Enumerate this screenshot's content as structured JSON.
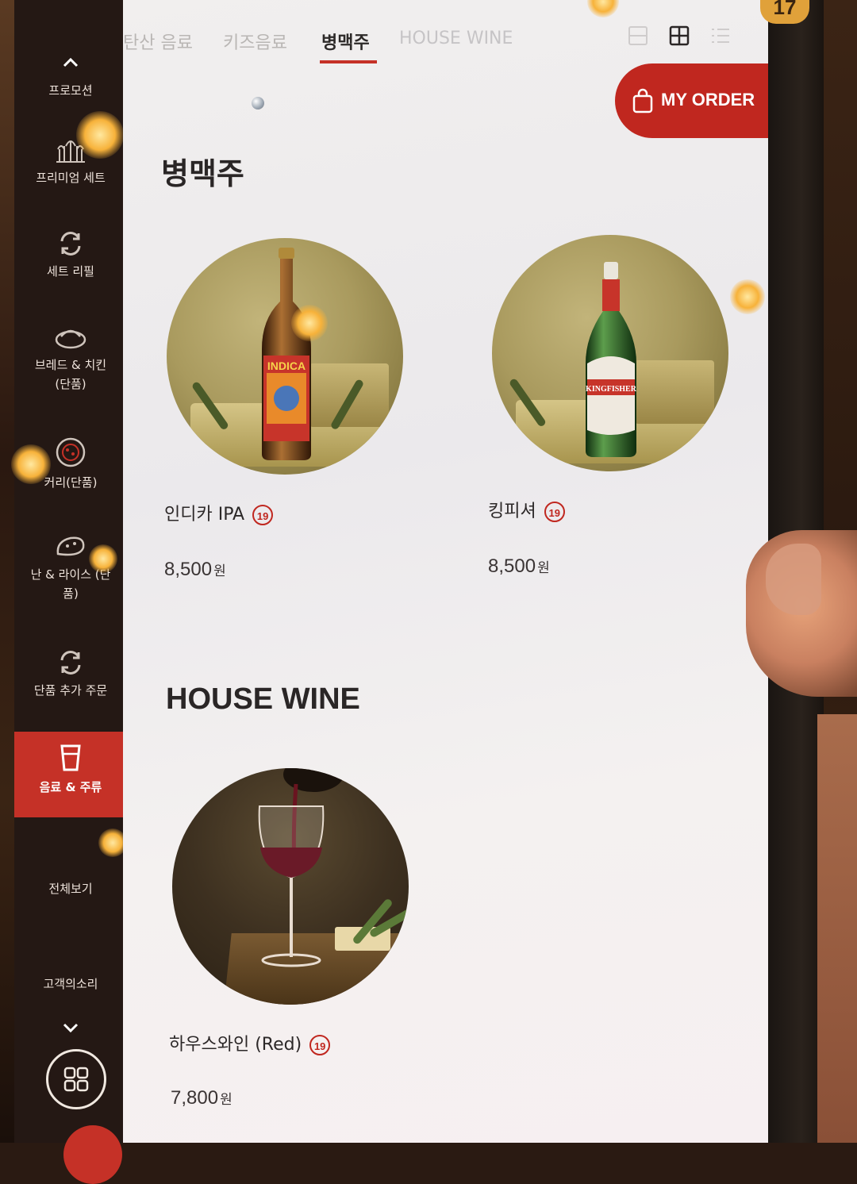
{
  "device": {
    "badge": "17"
  },
  "sidebar": {
    "items": [
      {
        "label": "프로모션",
        "icon": "chevron-up-icon"
      },
      {
        "label": "프리미엄 세트",
        "icon": "palace-icon"
      },
      {
        "label": "세트 리필",
        "icon": "refresh-icon"
      },
      {
        "label": "브레드 & 치킨\n(단품)",
        "line1": "브레드 & 치킨",
        "line2": "(단품)",
        "icon": "bread-icon"
      },
      {
        "label": "커리(단품)",
        "icon": "curry-bowl-icon"
      },
      {
        "label": "난 & 라이스 (단품)",
        "line1": "난 & 라이스 (단",
        "line2": "품)",
        "icon": "naan-icon"
      },
      {
        "label": "단품 추가 주문",
        "icon": "refresh-icon"
      },
      {
        "label": "음료 & 주류",
        "icon": "drink-cup-icon",
        "active": true
      },
      {
        "label": "전체보기"
      },
      {
        "label": "고객의소리"
      }
    ]
  },
  "tabs": [
    {
      "label": "탄산 음료"
    },
    {
      "label": "키즈음료"
    },
    {
      "label": "병맥주",
      "active": true
    },
    {
      "label": "HOUSE WINE"
    }
  ],
  "order_button": {
    "label": "MY ORDER"
  },
  "sections": [
    {
      "title": "병맥주",
      "products": [
        {
          "name": "인디카 IPA",
          "age": "19",
          "price": "8,500",
          "currency": "원",
          "bottle_label": "INDICA",
          "image": "indica-ipa-bottle"
        },
        {
          "name": "킹피셔",
          "age": "19",
          "price": "8,500",
          "currency": "원",
          "bottle_label": "KINGFISHER",
          "image": "kingfisher-bottle"
        }
      ]
    },
    {
      "title": "HOUSE WINE",
      "products": [
        {
          "name": "하우스와인 (Red)",
          "age": "19",
          "price": "7,800",
          "currency": "원",
          "image": "red-wine-glass"
        }
      ]
    }
  ],
  "colors": {
    "accent": "#c0271f",
    "sidebar": "#241814",
    "screen": "#efedee"
  }
}
